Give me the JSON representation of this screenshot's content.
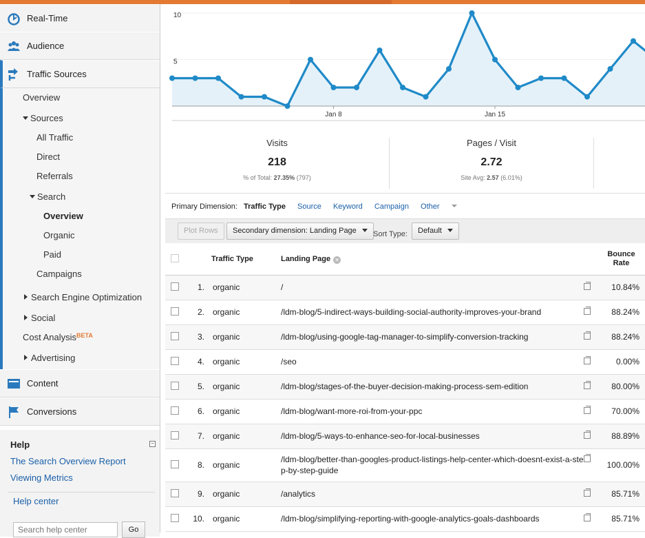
{
  "sidebar": {
    "sections": {
      "realtime": "Real-Time",
      "audience": "Audience",
      "traffic_sources": "Traffic Sources",
      "content": "Content",
      "conversions": "Conversions"
    },
    "nav": {
      "overview": "Overview",
      "sources": "Sources",
      "all_traffic": "All Traffic",
      "direct": "Direct",
      "referrals": "Referrals",
      "search": "Search",
      "search_overview": "Overview",
      "organic": "Organic",
      "paid": "Paid",
      "campaigns": "Campaigns",
      "seo": "Search Engine Optimization",
      "social": "Social",
      "cost_analysis": "Cost Analysis",
      "beta": "BETA",
      "advertising": "Advertising"
    },
    "help": {
      "title": "Help",
      "links": [
        "The Search Overview Report",
        "Viewing Metrics"
      ],
      "help_center": "Help center",
      "search_placeholder": "Search help center",
      "go": "Go"
    }
  },
  "chart_data": {
    "type": "area",
    "yticks": [
      "10",
      "5"
    ],
    "xticks": [
      "Jan 8",
      "Jan 15"
    ],
    "ylim": [
      0,
      10
    ],
    "values": [
      3,
      3,
      3,
      1,
      1,
      0,
      5,
      2,
      2,
      6,
      2,
      1,
      4,
      10,
      5,
      2,
      3,
      3,
      1,
      4,
      7,
      5
    ],
    "color": "#1f8ac8",
    "fill": "#e5f1f9"
  },
  "metrics": [
    {
      "title": "Visits",
      "value": "218",
      "sub_label": "% of Total:",
      "sub_bold": "27.35%",
      "sub_rest": "(797)"
    },
    {
      "title": "Pages / Visit",
      "value": "2.72",
      "sub_label": "Site Avg:",
      "sub_bold": "2.57",
      "sub_rest": "(6.01%)"
    }
  ],
  "dimensions": {
    "label": "Primary Dimension:",
    "active": "Traffic Type",
    "links": [
      "Source",
      "Keyword",
      "Campaign"
    ],
    "other": "Other"
  },
  "toolbar": {
    "plot_rows": "Plot Rows",
    "secondary": "Secondary dimension: Landing Page",
    "sort_label": "Sort Type:",
    "sort_value": "Default"
  },
  "table": {
    "headers": {
      "traffic_type": "Traffic Type",
      "landing_page": "Landing Page",
      "bounce_rate_1": "Bounce",
      "bounce_rate_2": "Rate"
    },
    "rows": [
      {
        "n": "1.",
        "type": "organic",
        "page": "/",
        "bounce": "10.84%"
      },
      {
        "n": "2.",
        "type": "organic",
        "page": "/ldm-blog/5-indirect-ways-building-social-authority-improves-your-brand",
        "bounce": "88.24%"
      },
      {
        "n": "3.",
        "type": "organic",
        "page": "/ldm-blog/using-google-tag-manager-to-simplify-conversion-tracking",
        "bounce": "88.24%"
      },
      {
        "n": "4.",
        "type": "organic",
        "page": "/seo",
        "bounce": "0.00%"
      },
      {
        "n": "5.",
        "type": "organic",
        "page": "/ldm-blog/stages-of-the-buyer-decision-making-process-sem-edition",
        "bounce": "80.00%"
      },
      {
        "n": "6.",
        "type": "organic",
        "page": "/ldm-blog/want-more-roi-from-your-ppc",
        "bounce": "70.00%"
      },
      {
        "n": "7.",
        "type": "organic",
        "page": "/ldm-blog/5-ways-to-enhance-seo-for-local-businesses",
        "bounce": "88.89%"
      },
      {
        "n": "8.",
        "type": "organic",
        "page": "/ldm-blog/better-than-googles-product-listings-help-center-which-doesnt-exist-a-step-by-step-guide",
        "bounce": "100.00%"
      },
      {
        "n": "9.",
        "type": "organic",
        "page": "/analytics",
        "bounce": "85.71%"
      },
      {
        "n": "10.",
        "type": "organic",
        "page": "/ldm-blog/simplifying-reporting-with-google-analytics-goals-dashboards",
        "bounce": "85.71%"
      }
    ]
  }
}
